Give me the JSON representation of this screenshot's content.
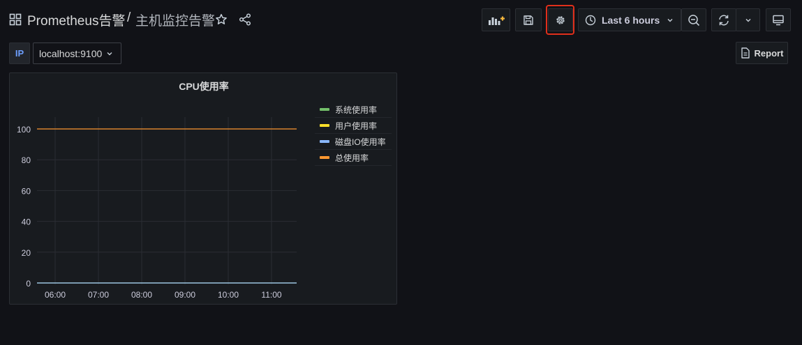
{
  "header": {
    "folder": "Prometheus告警",
    "separator": "/",
    "title": "主机监控告警",
    "time_range": "Last 6 hours"
  },
  "variables": {
    "ip_label": "IP",
    "ip_value": "localhost:9100"
  },
  "report_label": "Report",
  "panel": {
    "title": "CPU使用率",
    "legend": [
      {
        "name": "系统使用率",
        "color": "#73bf69"
      },
      {
        "name": "用户使用率",
        "color": "#fade2a"
      },
      {
        "name": "磁盘IO使用率",
        "color": "#8ab8ff"
      },
      {
        "name": "总使用率",
        "color": "#ff9830"
      }
    ]
  },
  "colors": {
    "accent_blue": "#6e9fff",
    "highlight_red": "#e02f1b"
  },
  "chart_data": {
    "type": "line",
    "x": [
      "06:00",
      "07:00",
      "08:00",
      "09:00",
      "10:00",
      "11:00"
    ],
    "ylim": [
      0,
      100
    ],
    "yticks": [
      0,
      20,
      40,
      60,
      80,
      100
    ],
    "series": [
      {
        "name": "系统使用率",
        "color": "#73bf69",
        "values": [
          0,
          0,
          0,
          0,
          0,
          0
        ]
      },
      {
        "name": "用户使用率",
        "color": "#fade2a",
        "values": [
          0,
          0,
          0,
          0,
          0,
          0
        ]
      },
      {
        "name": "磁盘IO使用率",
        "color": "#8ab8ff",
        "values": [
          0,
          0,
          0,
          0,
          0,
          0
        ]
      },
      {
        "name": "总使用率",
        "color": "#ff9830",
        "values": [
          100,
          100,
          100,
          100,
          100,
          100
        ]
      }
    ]
  }
}
